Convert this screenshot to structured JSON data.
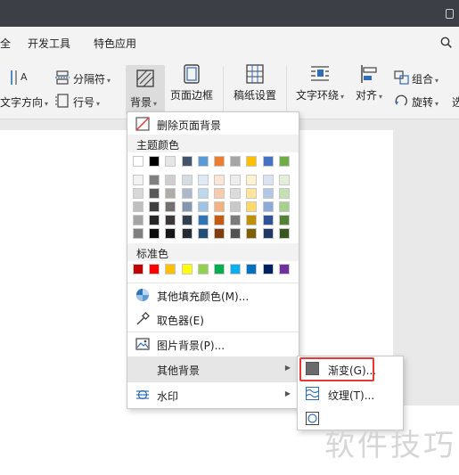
{
  "menubar": {
    "items": [
      {
        "label": "全"
      },
      {
        "label": "开发工具"
      },
      {
        "label": "特色应用"
      }
    ],
    "search_icon": "search-icon"
  },
  "toolbar": {
    "text_direction": "文字方向",
    "separator": "分隔符",
    "line_number": "行号",
    "background": "背景",
    "page_border": "页面边框",
    "manuscript": "稿纸设置",
    "text_wrap": "文字环绕",
    "align": "对齐",
    "group": "组合",
    "rotate": "旋转",
    "select_partial": "选"
  },
  "background_menu": {
    "remove": "删除页面背景",
    "theme_colors_title": "主题颜色",
    "theme_top": [
      "#ffffff",
      "#000000",
      "#e7e6e6",
      "#44546a",
      "#5b9bd5",
      "#ed7d31",
      "#a5a5a5",
      "#ffc000",
      "#4472c4",
      "#70ad47"
    ],
    "theme_shades": [
      [
        "#f2f2f2",
        "#7f7f7f",
        "#d0cece",
        "#d6dce4",
        "#deebf6",
        "#fbe5d5",
        "#ededed",
        "#fff2cc",
        "#dae3f3",
        "#e2efd9"
      ],
      [
        "#d8d8d8",
        "#595959",
        "#aeabab",
        "#adb9ca",
        "#bdd7ee",
        "#f7cbac",
        "#dbdbdb",
        "#fee599",
        "#b4c6e7",
        "#c5e0b3"
      ],
      [
        "#bfbfbf",
        "#3f3f3f",
        "#757070",
        "#8496b0",
        "#9dc3e6",
        "#f4b183",
        "#c9c9c9",
        "#ffd965",
        "#8eaadb",
        "#a8d08d"
      ],
      [
        "#a5a5a5",
        "#262626",
        "#3a3838",
        "#323f4f",
        "#2e75b5",
        "#c55a11",
        "#7b7b7b",
        "#bf9000",
        "#2f5496",
        "#538135"
      ],
      [
        "#7f7f7f",
        "#0c0c0c",
        "#171616",
        "#222a35",
        "#1f4e79",
        "#833c0b",
        "#525252",
        "#7f6000",
        "#1f3864",
        "#375623"
      ]
    ],
    "standard_colors_title": "标准色",
    "standard": [
      "#c00000",
      "#ff0000",
      "#ffc000",
      "#ffff00",
      "#92d050",
      "#00b050",
      "#00b0f0",
      "#0070c0",
      "#002060",
      "#7030a0"
    ],
    "more_fill": "其他填充颜色(M)...",
    "picker": "取色器(E)",
    "picture": "图片背景(P)...",
    "other": "其他背景",
    "watermark": "水印"
  },
  "submenu": {
    "gradient": "渐变(G)...",
    "texture": "纹理(T)..."
  },
  "watermark_text": "软件技巧"
}
